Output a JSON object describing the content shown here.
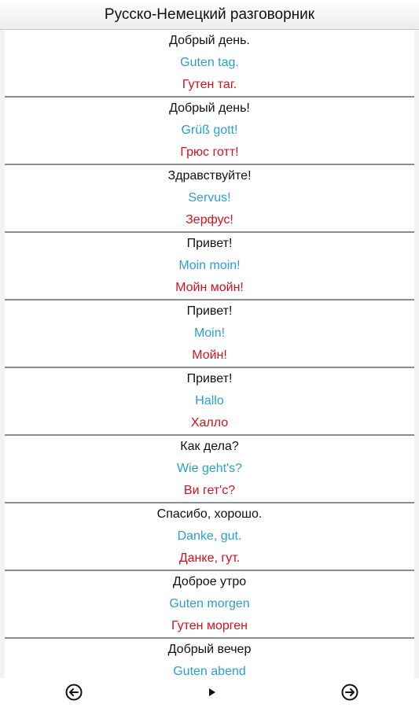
{
  "app": {
    "title": "Русско-Немецкий разговорник"
  },
  "phrases": [
    {
      "ru": "Добрый день.",
      "de": "Guten tag.",
      "tr": "Гутен таг."
    },
    {
      "ru": "Добрый день!",
      "de": "Grüß gott!",
      "tr": "Грюс готт!"
    },
    {
      "ru": "Здравствуйте!",
      "de": "Servus!",
      "tr": "Зерфус!"
    },
    {
      "ru": "Привет!",
      "de": "Moin moin!",
      "tr": "Мойн мойн!"
    },
    {
      "ru": "Привет!",
      "de": "Moin!",
      "tr": "Мойн!"
    },
    {
      "ru": "Привет!",
      "de": "Hallo",
      "tr": "Халло"
    },
    {
      "ru": "Как дела?",
      "de": "Wie geht's?",
      "tr": "Ви гет'с?"
    },
    {
      "ru": "Спасибо, хорошо.",
      "de": "Danke, gut.",
      "tr": "Данке, гут."
    },
    {
      "ru": "Доброе утро",
      "de": "Guten morgen",
      "tr": "Гутен морген"
    },
    {
      "ru": "Добрый вечер",
      "de": "Guten abend",
      "tr": ""
    }
  ],
  "colors": {
    "russian_text": "#111111",
    "german_text": "#2a9fd6",
    "transliteration_text": "#d8111b",
    "divider": "#8e8e8e"
  },
  "navigation": {
    "prev_icon": "arrow-left-circle-icon",
    "play_icon": "play-icon",
    "next_icon": "arrow-right-circle-icon"
  }
}
